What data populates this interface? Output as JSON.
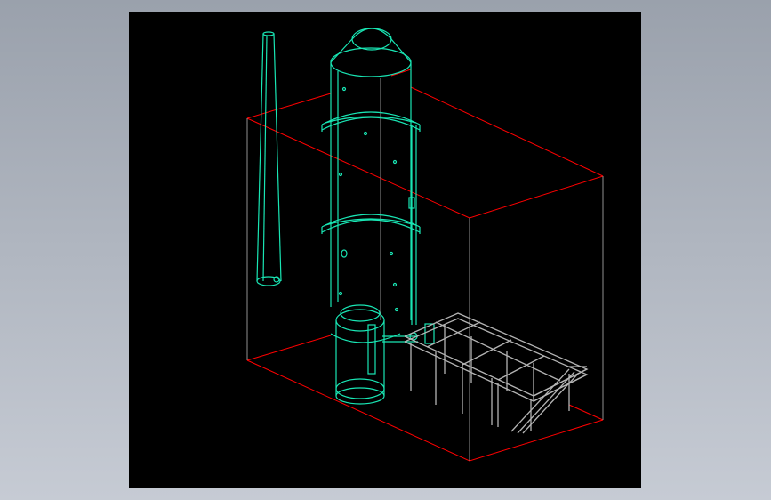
{
  "colors": {
    "background_top": "#9aa1ac",
    "background_bottom": "#c6cbd4",
    "canvas": "#000000",
    "equipment": "#19e6b4",
    "bounding_box": "#ff0000",
    "steel_frame": "#b4b4b4"
  }
}
